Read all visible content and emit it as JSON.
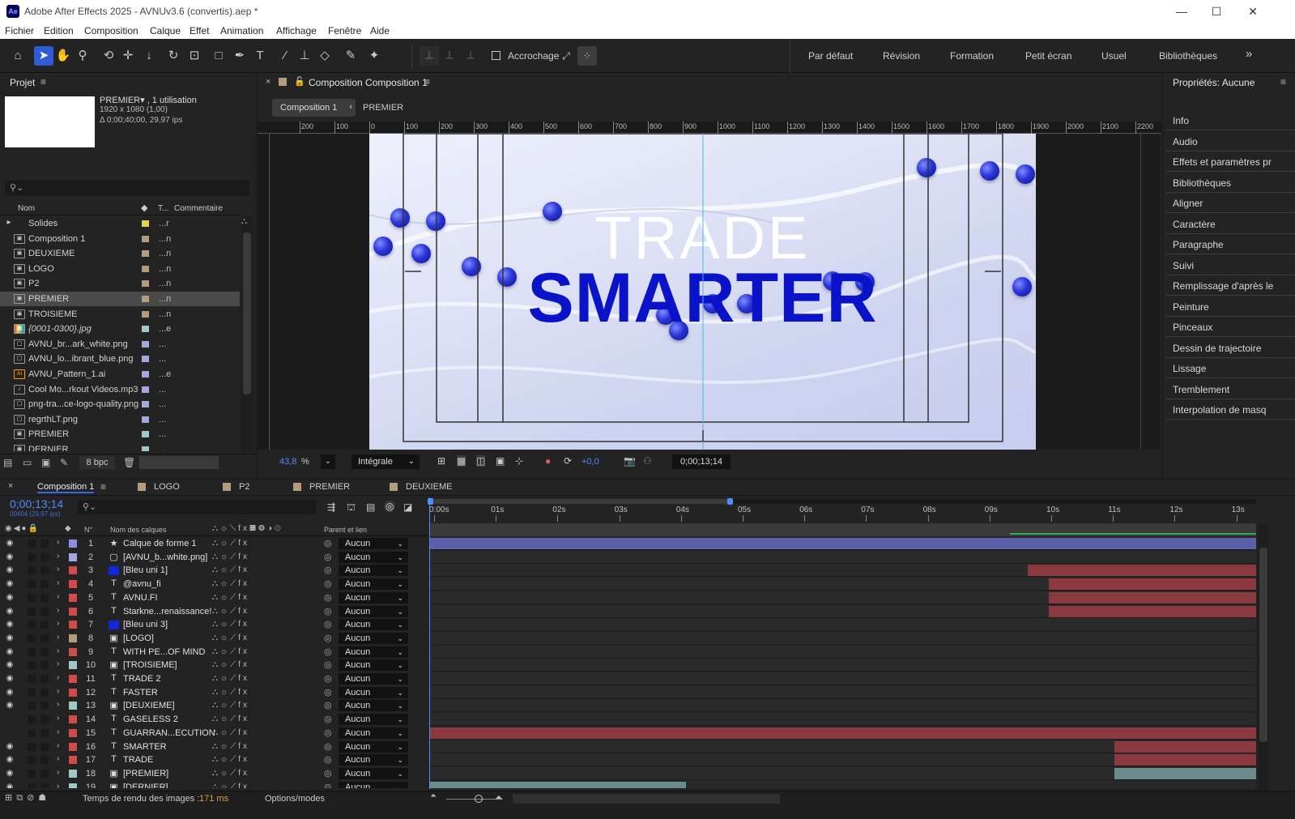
{
  "app": {
    "title": "Adobe After Effects 2025 - AVNUv3.6 (convertis).aep *",
    "logo": "Ae",
    "window_controls": [
      "—",
      "☐",
      "✕"
    ]
  },
  "menu": [
    "Fichier",
    "Edition",
    "Composition",
    "Calque",
    "Effet",
    "Animation",
    "Affichage",
    "Fenêtre",
    "Aide"
  ],
  "toolbar": {
    "snap_label": "Accrochage",
    "workspaces": [
      "Par défaut",
      "Révision",
      "Formation",
      "Petit écran",
      "Usuel",
      "Bibliothèques"
    ],
    "more": "»"
  },
  "project": {
    "title": "Projet",
    "selected_name": "PREMIER▾ , 1 utilisation",
    "selected_res": "1920 x 1080 (1,00)",
    "selected_dur": "Δ 0;00;40;00, 29,97 ips",
    "search_placeholder": "",
    "col_name": "Nom",
    "col_type": "T...",
    "col_comment": "Commentaire",
    "items": [
      {
        "name": "Solides",
        "color": "#e0d24a",
        "type": "...r",
        "icon": "folder-icon",
        "glyph": "▸"
      },
      {
        "name": "Composition 1",
        "color": "#b39c7e",
        "type": "...n",
        "icon": "composition-icon",
        "glyph": "▣"
      },
      {
        "name": "DEUXIEME",
        "color": "#b39c7e",
        "type": "...n",
        "icon": "composition-icon",
        "glyph": "▣"
      },
      {
        "name": "LOGO",
        "color": "#b39c7e",
        "type": "...n",
        "icon": "composition-icon",
        "glyph": "▣"
      },
      {
        "name": "P2",
        "color": "#b39c7e",
        "type": "...n",
        "icon": "composition-icon",
        "glyph": "▣"
      },
      {
        "name": "PREMIER",
        "color": "#b39c7e",
        "type": "...n",
        "icon": "composition-icon",
        "glyph": "▣"
      },
      {
        "name": "TROISIEME",
        "color": "#b39c7e",
        "type": "...n",
        "icon": "composition-icon",
        "glyph": "▣"
      },
      {
        "name": "{0001-0300}.jpg",
        "color": "#9fc8c8",
        "type": "...e",
        "icon": "image-sequence-icon",
        "glyph": "▦"
      },
      {
        "name": "AVNU_br...ark_white.png",
        "color": "#a7a7e0",
        "type": "...",
        "icon": "image-file-icon",
        "glyph": "▢"
      },
      {
        "name": "AVNU_lo...ibrant_blue.png",
        "color": "#a7a7e0",
        "type": "...",
        "icon": "image-file-icon",
        "glyph": "▢"
      },
      {
        "name": "AVNU_Pattern_1.ai",
        "color": "#a7a7e0",
        "type": "...e",
        "icon": "illustrator-file-icon",
        "glyph": "Ai"
      },
      {
        "name": "Cool Mo...rkout Videos.mp3",
        "color": "#a7a7e0",
        "type": "...",
        "icon": "audio-file-icon",
        "glyph": "♪"
      },
      {
        "name": "png-tra...ce-logo-quality.png",
        "color": "#a7a7e0",
        "type": "...",
        "icon": "image-file-icon",
        "glyph": "▢"
      },
      {
        "name": "regrthLT.png",
        "color": "#a7a7e0",
        "type": "...",
        "icon": "image-file-icon",
        "glyph": "▢"
      },
      {
        "name": "PREMIER",
        "color": "#9fc8c8",
        "type": "...",
        "icon": "composition-icon",
        "glyph": "▣"
      },
      {
        "name": "DERNIER",
        "color": "#9fc8c8",
        "type": "...",
        "icon": "composition-icon",
        "glyph": "▣"
      }
    ],
    "selected_index": 5,
    "bpc": "8 bpc"
  },
  "comp": {
    "panel_title": "Composition Composition 1",
    "tabs": [
      "Composition 1",
      "PREMIER"
    ],
    "ruler": [
      "200",
      "100",
      "0",
      "100",
      "200",
      "300",
      "400",
      "500",
      "600",
      "700",
      "800",
      "900",
      "1000",
      "1100",
      "1200",
      "1300",
      "1400",
      "1500",
      "1600",
      "1700",
      "1800",
      "1900",
      "2000",
      "2100",
      "2200"
    ],
    "headline_line1": "TRADE",
    "headline_line2": "SMARTER",
    "zoom": "43,8",
    "zoom_unit": "%",
    "resolution": "Intégrale",
    "exposure": "+0,0",
    "timecode": "0;00;13;14"
  },
  "properties": {
    "title": "Propriétés: Aucune",
    "items": [
      "Info",
      "Audio",
      "Effets et paramètres pr",
      "Bibliothèques",
      "Aligner",
      "Caractère",
      "Paragraphe",
      "Suivi",
      "Remplissage d'après le",
      "Peinture",
      "Pinceaux",
      "Dessin de trajectoire",
      "Lissage",
      "Tremblement",
      "Interpolation de masq"
    ]
  },
  "timeline": {
    "tabs": [
      "Composition 1",
      "LOGO",
      "P2",
      "PREMIER",
      "DEUXIEME"
    ],
    "tab_colors": [
      "#b39c7e",
      "#b39c7e",
      "#b39c7e",
      "#b39c7e",
      "#b39c7e"
    ],
    "timecode": "0;00;13;14",
    "frames": "00404 (29,97 ips)",
    "col_layer_name": "Nom des calques",
    "col_number": "N°",
    "col_parent": "Parent et lien",
    "time_labels": [
      "0:00s",
      "01s",
      "02s",
      "03s",
      "04s",
      "05s",
      "06s",
      "07s",
      "08s",
      "09s",
      "10s",
      "11s",
      "12s",
      "13s"
    ],
    "layers": [
      {
        "n": "1",
        "name": "Calque de forme 1",
        "type": "★",
        "color": "#8e8ee6",
        "parent": "Aucun",
        "bar_start": 0,
        "bar_end": 1,
        "bar_color": "#5b5fa8"
      },
      {
        "n": "2",
        "name": "[AVNU_b...white.png]",
        "type": "▢",
        "color": "#a7a7e0",
        "parent": "Aucun",
        "bar_start": 0,
        "bar_end": 0,
        "bar_color": ""
      },
      {
        "n": "3",
        "name": "[Bleu uni 1]",
        "type": "■",
        "color": "#d24b4b",
        "parent": "Aucun",
        "bar_start": 0.724,
        "bar_end": 1,
        "bar_color": "#8a3a3f"
      },
      {
        "n": "4",
        "name": "@avnu_fi",
        "type": "T",
        "color": "#d24b4b",
        "parent": "Aucun",
        "bar_start": 0.749,
        "bar_end": 1,
        "bar_color": "#8a3a3f"
      },
      {
        "n": "5",
        "name": "AVNU.FI",
        "type": "T",
        "color": "#d24b4b",
        "parent": "Aucun",
        "bar_start": 0.749,
        "bar_end": 1,
        "bar_color": "#8a3a3f"
      },
      {
        "n": "6",
        "name": "Starkne...renaissance!",
        "type": "T",
        "color": "#d24b4b",
        "parent": "Aucun",
        "bar_start": 0.749,
        "bar_end": 1,
        "bar_color": "#8a3a3f"
      },
      {
        "n": "7",
        "name": "[Bleu uni 3]",
        "type": "■",
        "color": "#d24b4b",
        "parent": "Aucun",
        "bar_start": 0,
        "bar_end": 0,
        "bar_color": ""
      },
      {
        "n": "8",
        "name": "[LOGO]",
        "type": "▣",
        "color": "#b39c7e",
        "parent": "Aucun",
        "bar_start": 0,
        "bar_end": 0,
        "bar_color": ""
      },
      {
        "n": "9",
        "name": "WITH PE...OF MIND",
        "type": "T",
        "color": "#d24b4b",
        "parent": "Aucun",
        "bar_start": 0,
        "bar_end": 0,
        "bar_color": ""
      },
      {
        "n": "10",
        "name": "[TROISIEME]",
        "type": "▣",
        "color": "#9fc8c8",
        "parent": "Aucun",
        "bar_start": 0,
        "bar_end": 0,
        "bar_color": ""
      },
      {
        "n": "11",
        "name": "TRADE 2",
        "type": "T",
        "color": "#d24b4b",
        "parent": "Aucun",
        "bar_start": 0,
        "bar_end": 0,
        "bar_color": ""
      },
      {
        "n": "12",
        "name": "FASTER",
        "type": "T",
        "color": "#d24b4b",
        "parent": "Aucun",
        "bar_start": 0,
        "bar_end": 0,
        "bar_color": ""
      },
      {
        "n": "13",
        "name": "[DEUXIEME]",
        "type": "▣",
        "color": "#9fc8c8",
        "parent": "Aucun",
        "bar_start": 0,
        "bar_end": 0,
        "bar_color": ""
      },
      {
        "n": "14",
        "name": "GASELESS 2",
        "type": "T",
        "color": "#d24b4b",
        "parent": "Aucun",
        "bar_start": 0,
        "bar_end": 0,
        "bar_color": ""
      },
      {
        "n": "15",
        "name": "GUARRAN...ECUTION",
        "type": "T",
        "color": "#d24b4b",
        "parent": "Aucun",
        "bar_start": 0,
        "bar_end": 1,
        "bar_color": "#8a3a3f"
      },
      {
        "n": "16",
        "name": "SMARTER",
        "type": "T",
        "color": "#d24b4b",
        "parent": "Aucun",
        "bar_start": 0.829,
        "bar_end": 1,
        "bar_color": "#8a3a3f"
      },
      {
        "n": "17",
        "name": "TRADE",
        "type": "T",
        "color": "#d24b4b",
        "parent": "Aucun",
        "bar_start": 0.829,
        "bar_end": 1,
        "bar_color": "#8a3a3f"
      },
      {
        "n": "18",
        "name": "[PREMIER]",
        "type": "▣",
        "color": "#9fc8c8",
        "parent": "Aucun",
        "bar_start": 0.829,
        "bar_end": 1,
        "bar_color": "#6a8c8c"
      },
      {
        "n": "19",
        "name": "[DERNIER]",
        "type": "▣",
        "color": "#9fc8c8",
        "parent": "Aucun",
        "bar_start": 0,
        "bar_end": 0.31,
        "bar_color": "#6a8c8c"
      }
    ],
    "render_time_label": "Temps de rendu des images :",
    "render_time_value": "171 ms",
    "mode_label": "Options/modes"
  }
}
